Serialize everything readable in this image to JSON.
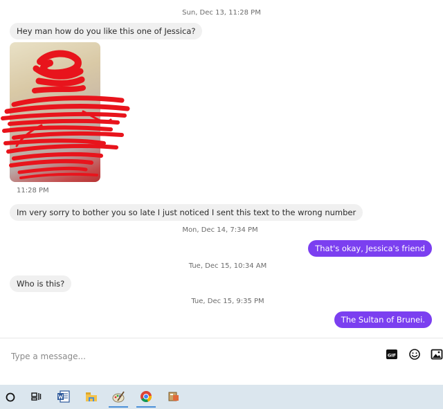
{
  "conversation": {
    "timestamps": {
      "t1": "Sun, Dec 13, 11:28 PM",
      "t2": "Mon, Dec 14, 7:34 PM",
      "t3": "Tue, Dec 15, 10:34 AM",
      "t4": "Tue, Dec 15, 9:35 PM"
    },
    "messages": {
      "m1": "Hey man how do you like this one of Jessica?",
      "photo_time": "11:28 PM",
      "m2": "Im very sorry to bother you so late I just noticed I sent this text to the wrong number",
      "m3": "That's okay, Jessica's friend",
      "m4": "Who is this?",
      "m5": "The Sultan of Brunei."
    }
  },
  "composer": {
    "placeholder": "Type a message...",
    "gif_label": "GIF",
    "icons": [
      "gif-icon",
      "emoji-icon",
      "image-icon"
    ]
  },
  "taskbar": {
    "icons": [
      "cortana-icon",
      "task-view-icon",
      "word-icon",
      "file-explorer-icon",
      "paint-icon",
      "chrome-icon",
      "app-icon"
    ]
  },
  "colors": {
    "outgoing_bubble": "#7b3ff0",
    "incoming_bubble": "#f0f0f0",
    "scribble": "#e8141c",
    "taskbar": "#dbe6ee"
  }
}
